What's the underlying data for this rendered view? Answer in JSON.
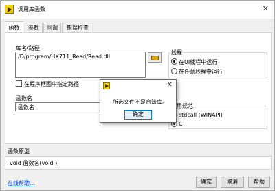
{
  "window": {
    "title": "调用库函数",
    "close": "✕"
  },
  "tabs": [
    "函数",
    "参数",
    "回调",
    "错误检查"
  ],
  "library": {
    "label": "库名/路径",
    "value": "/D/program/HX711_Read/Read.dll",
    "checkbox_label": "在程序框图中指定路径"
  },
  "function": {
    "label": "函数名",
    "value": "函数名"
  },
  "thread": {
    "label": "线程",
    "options": [
      "在UI线程中运行",
      "在任意线程中运行"
    ],
    "selected": 0
  },
  "convention": {
    "label": "调用规范",
    "options": [
      "stdcall (WINAPI)",
      "C"
    ],
    "selected": 1
  },
  "prototype": {
    "label": "函数原型",
    "value": "void  函数名(void );"
  },
  "help_link": "在线帮助...",
  "buttons": {
    "ok": "确定",
    "cancel": "取消",
    "help": "帮助"
  },
  "modal": {
    "message": "所选文件不是合法库。",
    "ok": "确定",
    "close": "✕"
  }
}
